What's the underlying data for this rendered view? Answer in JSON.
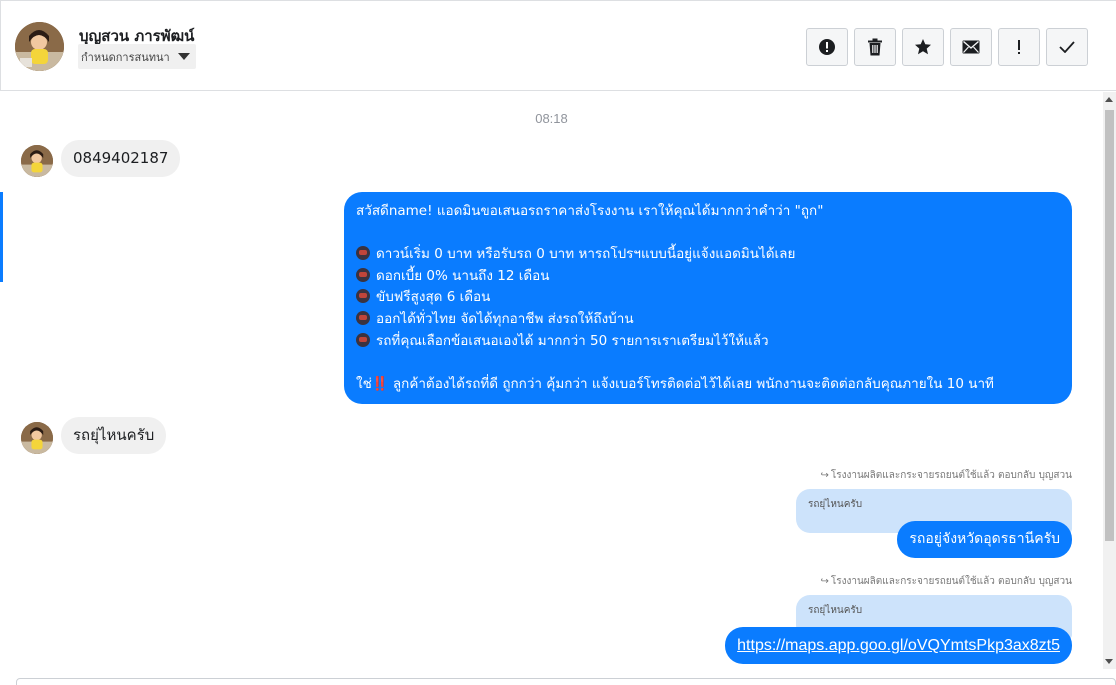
{
  "header": {
    "contact_name": "บุญสวน ภารพัฒน์",
    "label_selector": "กำหนดการสนทนา",
    "actions": [
      {
        "name": "spam-button",
        "icon": "exclamation-circle-icon"
      },
      {
        "name": "delete-button",
        "icon": "trash-icon"
      },
      {
        "name": "star-button",
        "icon": "star-icon"
      },
      {
        "name": "mark-unread-button",
        "icon": "envelope-icon"
      },
      {
        "name": "follow-up-button",
        "icon": "exclamation-icon"
      },
      {
        "name": "mark-done-button",
        "icon": "checkmark-icon"
      }
    ]
  },
  "thread": {
    "timestamp": "08:18",
    "msg1": "0849402187",
    "outgoing": {
      "line1": "สวัสดีname! แอดมินขอเสนอรถราคาส่งโรงงาน เราให้คุณได้มากกว่าคำว่า \"ถูก\"",
      "bullets": [
        "ดาวน์เริ่ม 0 บาท หรือรับรถ 0 บาท หารถโปรฯแบบนี้อยู่แจ้งแอดมินได้เลย",
        "ดอกเบี้ย 0% นานถึง 12 เดือน",
        "ขับฟรีสูงสุด 6 เดือน",
        "ออกได้ทั่วไทย จัดได้ทุกอาชีพ ส่งรถให้ถึงบ้าน",
        "รถที่คุณเลือกข้อเสนอเองได้ มากกว่า 50 รายการเราเตรียมไว้ให้แล้ว"
      ],
      "closing_prefix": "ใช่",
      "closing_mark": "‼️",
      "closing_text": " ลูกค้าต้องได้รถที่ดี ถูกกว่า คุ้มกว่า แจ้งเบอร์โทรติดต่อไว้ได้เลย พนักงานจะติดต่อกลับคุณภายใน 10 นาที"
    },
    "msg2": "รถยุ่ไหนครับ",
    "reply1": {
      "meta": "โรงงานผลิตและกระจายรถยนต์ใช้แล้ว ตอบกลับ บุญสวน",
      "quote": "รถยุ่ไหนครับ",
      "text": "รถอยู่จังหวัดอุดรธานีครับ"
    },
    "reply2": {
      "meta": "โรงงานผลิตและกระจายรถยนต์ใช้แล้ว ตอบกลับ บุญสวน",
      "quote": "รถยุ่ไหนครับ",
      "link": "https://maps.app.goo.gl/oVQYmtsPkp3ax8zt5"
    }
  },
  "colors": {
    "accent": "#0a7cff",
    "incoming_bubble": "#f0f0f0",
    "quote_bubble": "#cde3fb"
  }
}
